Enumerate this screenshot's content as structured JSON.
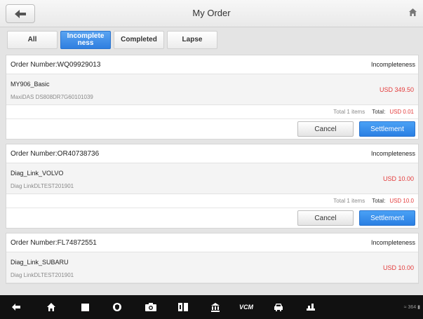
{
  "header": {
    "title": "My Order"
  },
  "tabs": [
    {
      "label": "All"
    },
    {
      "label": "Incomplete ness"
    },
    {
      "label": "Completed"
    },
    {
      "label": "Lapse"
    }
  ],
  "orders": [
    {
      "order_number": "Order Number:WQ09929013",
      "status": "Incompleteness",
      "item_name": "MY906_Basic",
      "item_serial": "MaxiDAS DS808DR7G60101039",
      "price": "USD 349.50",
      "total_items": "Total 1 items",
      "total_label": "Total:",
      "total_value": "USD 0.01",
      "cancel_label": "Cancel",
      "settle_label": "Settlement"
    },
    {
      "order_number": "Order Number:OR40738736",
      "status": "Incompleteness",
      "item_name": "Diag_Link_VOLVO",
      "item_serial": "Diag LinkDLTEST201901",
      "price": "USD 10.00",
      "total_items": "Total 1 items",
      "total_label": "Total:",
      "total_value": "USD 10.0",
      "cancel_label": "Cancel",
      "settle_label": "Settlement"
    },
    {
      "order_number": "Order Number:FL74872551",
      "status": "Incompleteness",
      "item_name": "Diag_Link_SUBARU",
      "item_serial": "Diag LinkDLTEST201901",
      "price": "USD 10.00"
    }
  ],
  "navbar": {
    "icons": [
      "back-arrow-icon",
      "home-icon",
      "recent-apps-icon",
      "shield-icon",
      "camera-icon",
      "split-screen-icon",
      "bank-icon",
      "vci-icon",
      "car-icon",
      "network-icon"
    ],
    "vci_label": "VCM",
    "status": "≈ 364 ▮"
  }
}
